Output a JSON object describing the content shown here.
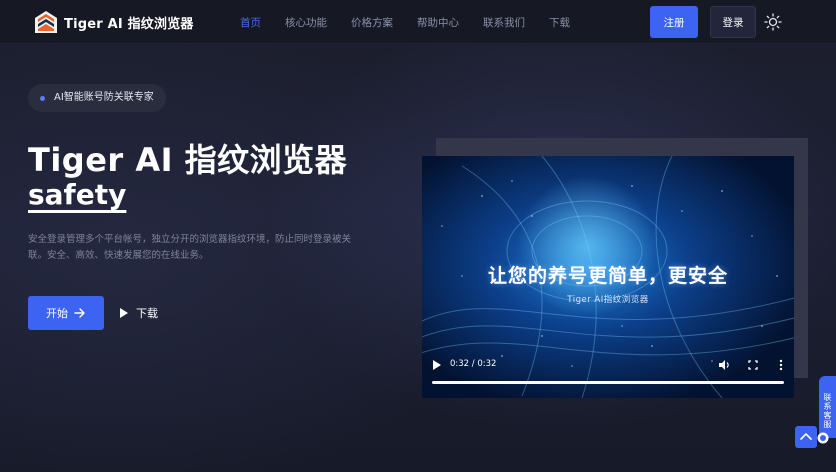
{
  "header": {
    "brand": "Tiger AI 指纹浏览器",
    "nav": [
      "首页",
      "核心功能",
      "价格方案",
      "帮助中心",
      "联系我们",
      "下载"
    ],
    "active_nav": "首页",
    "register_label": "注册",
    "login_label": "登录",
    "theme_icon": "sun-icon"
  },
  "hero": {
    "badge": "AI智能账号防关联专家",
    "title": "Tiger AI 指纹浏览器",
    "subtitle": "safety",
    "description": "安全登录管理多个平台帐号，独立分开的浏览器指纹环境，防止同时登录被关联。安全、高效、快速发展您的在线业务。",
    "start_label": "开始",
    "download_label": "下载"
  },
  "video": {
    "headline": "让您的养号更简单，更安全",
    "subline": "Tiger AI指纹浏览器",
    "time": "0:32 / 0:32",
    "progress": 1.0
  },
  "floating": {
    "tab_label": "联系客服"
  },
  "colors": {
    "accent": "#3d63f2",
    "nav_active": "#4a6cf7",
    "background": "#1c1e2c"
  }
}
